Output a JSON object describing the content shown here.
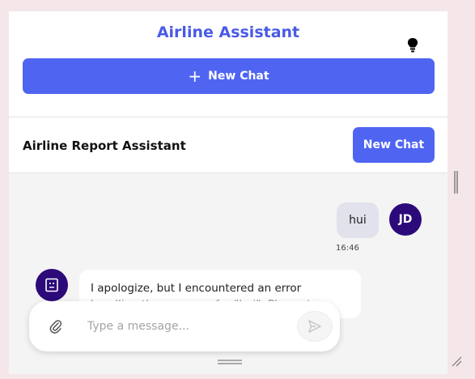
{
  "header": {
    "title": "Airline Assistant",
    "new_chat_label": "New Chat",
    "bulb_icon": "lightbulb-icon"
  },
  "section": {
    "title": "Airline Report Assistant",
    "new_chat_label": "New Chat"
  },
  "messages": [
    {
      "role": "user",
      "text": "hui",
      "time": "16:46",
      "avatar": "JD"
    },
    {
      "role": "assistant",
      "line1": "I apologize, but I encountered an error",
      "line2": "handling the message for \"hui\". Please try"
    }
  ],
  "composer": {
    "placeholder": "Type a message...",
    "attach_icon": "paperclip-icon",
    "send_icon": "send-icon"
  },
  "colors": {
    "accent": "#4f65f2",
    "title": "#4a5be6",
    "avatar": "#2c0a7a",
    "page_bg": "#f5e6ea"
  }
}
